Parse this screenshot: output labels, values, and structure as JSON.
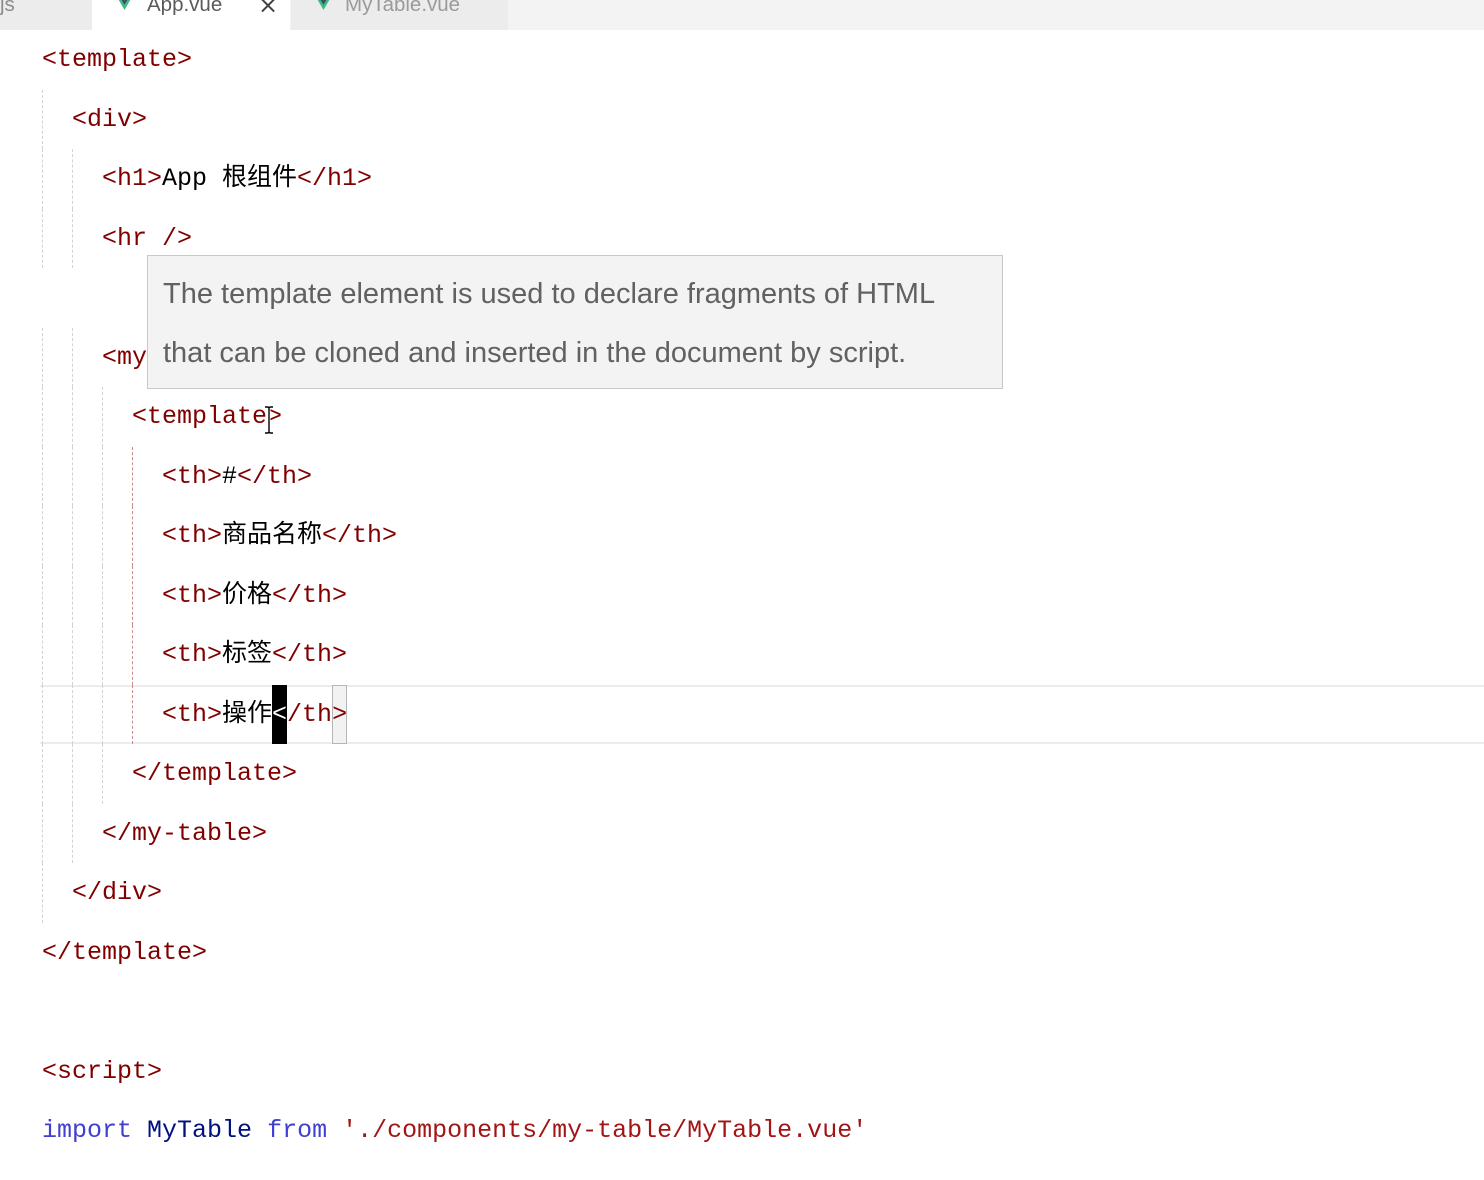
{
  "tabs": [
    {
      "label": "js",
      "active": false
    },
    {
      "label": "App.vue",
      "active": true,
      "icon": "vue-icon",
      "close_glyph": "×"
    },
    {
      "label": "MyTable.vue",
      "active": false,
      "icon": "vue-icon"
    }
  ],
  "editor": {
    "lines": [
      {
        "indent": 0,
        "tokens": [
          {
            "t": "<template>",
            "c": "tag"
          }
        ]
      },
      {
        "indent": 1,
        "tokens": [
          {
            "t": "<div>",
            "c": "tag"
          }
        ]
      },
      {
        "indent": 2,
        "tokens": [
          {
            "t": "<h1>",
            "c": "tag"
          },
          {
            "t": "App 根组件",
            "c": "txt"
          },
          {
            "t": "</h1>",
            "c": "tag"
          }
        ]
      },
      {
        "indent": 2,
        "tokens": [
          {
            "t": "<hr />",
            "c": "tag"
          }
        ]
      },
      {
        "indent": 0,
        "tokens": []
      },
      {
        "indent": 2,
        "tokens": [
          {
            "t": "<my",
            "c": "tag"
          }
        ]
      },
      {
        "indent": 3,
        "tokens": [
          {
            "t": "<template>",
            "c": "tag"
          }
        ]
      },
      {
        "indent": 4,
        "tokens": [
          {
            "t": "<th>",
            "c": "tag"
          },
          {
            "t": "#",
            "c": "txt"
          },
          {
            "t": "</th>",
            "c": "tag"
          }
        ]
      },
      {
        "indent": 4,
        "tokens": [
          {
            "t": "<th>",
            "c": "tag"
          },
          {
            "t": "商品名称",
            "c": "txt"
          },
          {
            "t": "</th>",
            "c": "tag"
          }
        ]
      },
      {
        "indent": 4,
        "tokens": [
          {
            "t": "<th>",
            "c": "tag"
          },
          {
            "t": "价格",
            "c": "txt"
          },
          {
            "t": "</th>",
            "c": "tag"
          }
        ]
      },
      {
        "indent": 4,
        "tokens": [
          {
            "t": "<th>",
            "c": "tag"
          },
          {
            "t": "标签",
            "c": "txt"
          },
          {
            "t": "</th>",
            "c": "tag"
          }
        ]
      },
      {
        "indent": 4,
        "current": true,
        "tokens": [
          {
            "t": "<th>",
            "c": "tag"
          },
          {
            "t": "操作",
            "c": "txt"
          },
          {
            "t": "<",
            "c": "tag",
            "state": "cursor"
          },
          {
            "t": "/th",
            "c": "tag"
          },
          {
            "t": ">",
            "c": "tag",
            "state": "bracket-match"
          }
        ]
      },
      {
        "indent": 3,
        "tokens": [
          {
            "t": "</template>",
            "c": "tag"
          }
        ]
      },
      {
        "indent": 2,
        "tokens": [
          {
            "t": "</my-table>",
            "c": "tag"
          }
        ]
      },
      {
        "indent": 1,
        "tokens": [
          {
            "t": "</div>",
            "c": "tag"
          }
        ]
      },
      {
        "indent": 0,
        "tokens": [
          {
            "t": "</template>",
            "c": "tag"
          }
        ]
      },
      {
        "indent": 0,
        "tokens": []
      },
      {
        "indent": 0,
        "tokens": [
          {
            "t": "<script>",
            "c": "tag"
          }
        ]
      },
      {
        "indent": 0,
        "tokens": [
          {
            "t": "import",
            "c": "kw"
          },
          {
            "t": " ",
            "c": "txt"
          },
          {
            "t": "MyTable",
            "c": "var"
          },
          {
            "t": " ",
            "c": "txt"
          },
          {
            "t": "from",
            "c": "kw"
          },
          {
            "t": " ",
            "c": "txt"
          },
          {
            "t": "'./components/my-table/MyTable.vue'",
            "c": "str"
          }
        ]
      }
    ]
  },
  "hover": {
    "lines": [
      "The template element is used to declare fragments of HTML",
      "that can be cloned and inserted in the document by script."
    ]
  },
  "colors": {
    "tag": "#800000",
    "txt": "#000000",
    "kw": "#3f3fd1",
    "var": "#001080",
    "str": "#a31515",
    "vue_green": "#41b883",
    "vue_dark": "#35495e"
  }
}
